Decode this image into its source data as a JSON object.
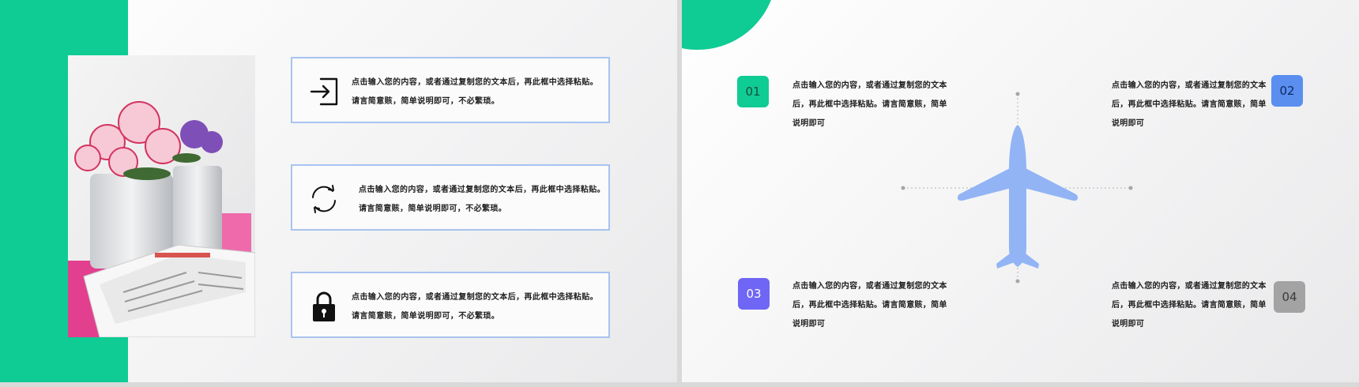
{
  "colors": {
    "green": "#0fcb94",
    "blue_border": "#a8c3ef",
    "plane_blue": "#92b4f5",
    "badge_blue": "#5a8ff0",
    "badge_purple": "#6f66f5",
    "badge_gray": "#a3a3a3"
  },
  "left_slide": {
    "cards": [
      {
        "icon": "login-arrow-icon",
        "line1": "点击输入您的内容，或者通过复制您的文本后，再此框中选择粘贴。",
        "line2": "请言简意赅，简单说明即可，不必繁琐。"
      },
      {
        "icon": "refresh-icon",
        "line1": "点击输入您的内容，或者通过复制您的文本后，再此框中选择粘贴。",
        "line2": "请言简意赅，简单说明即可，不必繁琐。"
      },
      {
        "icon": "lock-icon",
        "line1": "点击输入您的内容，或者通过复制您的文本后，再此框中选择粘贴。",
        "line2": "请言简意赅，简单说明即可，不必繁琐。"
      }
    ]
  },
  "right_slide": {
    "icon": "airplane-icon",
    "points": [
      {
        "number": "01",
        "color": "#0fcb94",
        "lines": [
          "点击输入您的内容，或者通过复制您的文本",
          "后，再此框中选择粘贴。请言简意赅，简单",
          "说明即可"
        ]
      },
      {
        "number": "02",
        "color": "#5a8ff0",
        "lines": [
          "点击输入您的内容，或者通过复制您的文本",
          "后，再此框中选择粘贴。请言简意赅，简单",
          "说明即可"
        ]
      },
      {
        "number": "03",
        "color": "#6f66f5",
        "lines": [
          "点击输入您的内容，或者通过复制您的文本",
          "后，再此框中选择粘贴。请言简意赅，简单",
          "说明即可"
        ]
      },
      {
        "number": "04",
        "color": "#a3a3a3",
        "lines": [
          "点击输入您的内容，或者通过复制您的文本",
          "后，再此框中选择粘贴。请言简意赅，简单",
          "说明即可"
        ]
      }
    ]
  }
}
